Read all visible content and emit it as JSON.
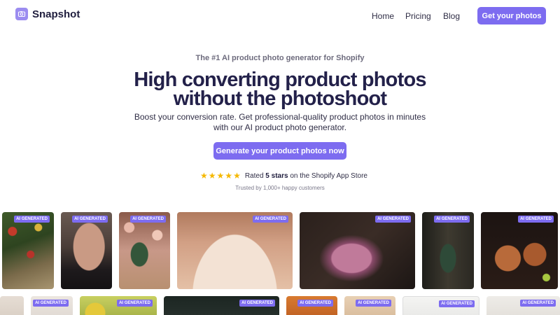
{
  "nav": {
    "brand": "Snapshot",
    "links": [
      "Home",
      "Pricing",
      "Blog"
    ],
    "cta": "Get your photos"
  },
  "hero": {
    "eyebrow": "The #1 AI product photo generator for Shopify",
    "headline_1": "High converting product photos",
    "headline_2": "without the photoshoot",
    "subtitle": "Boost your conversion rate. Get professional-quality product photos in minutes with our AI product photo generator.",
    "cta": "Generate your product photos now",
    "rating_prefix": "Rated ",
    "rating_bold": "5 stars",
    "rating_suffix": " on the Shopify App Store",
    "stars": 5,
    "trusted": "Trusted by 1,000+ happy customers"
  },
  "gallery": {
    "badge": "AI GENERATED"
  },
  "colors": {
    "accent": "#7d6cf0",
    "heading": "#23214a",
    "star": "#f5b800"
  }
}
